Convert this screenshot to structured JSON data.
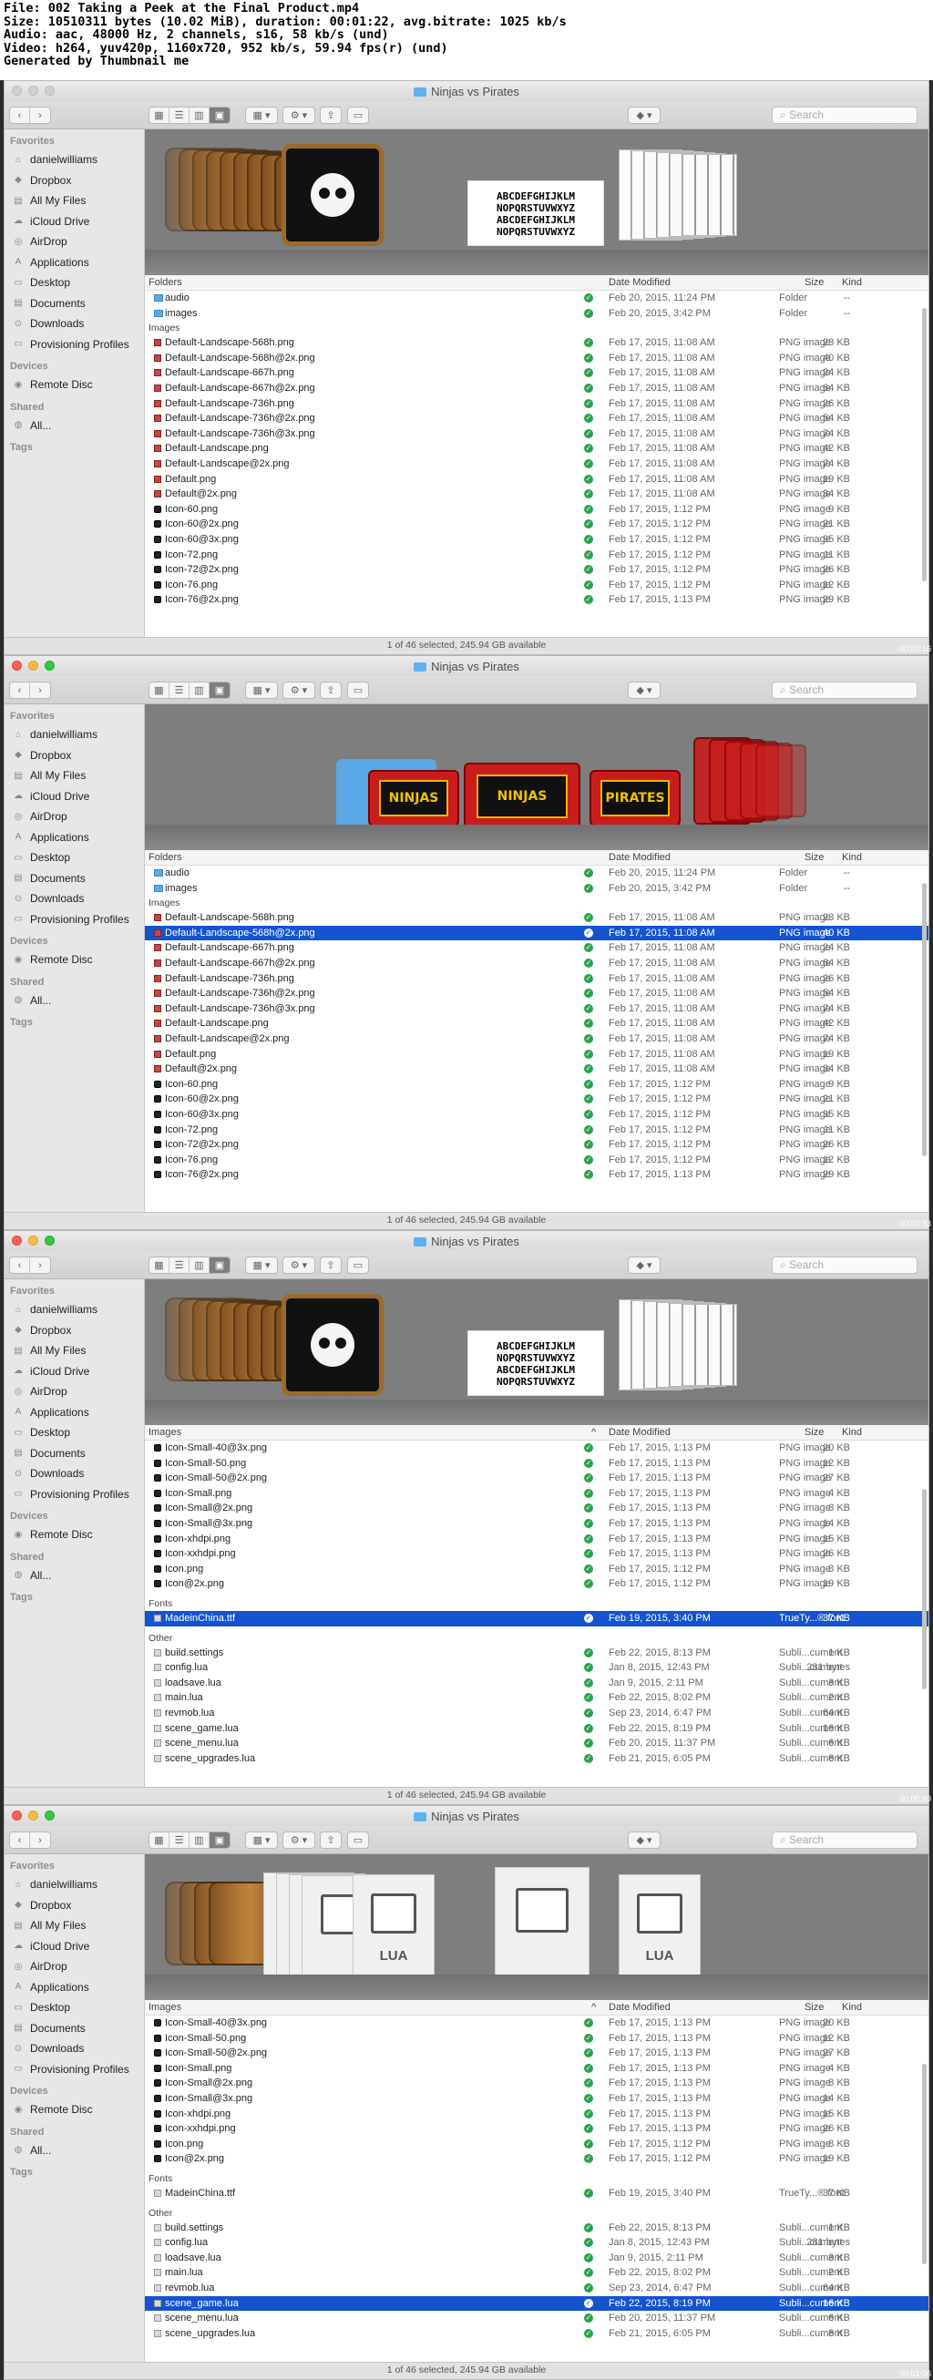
{
  "header": [
    "File: 002 Taking a Peek at the Final Product.mp4",
    "Size: 10510311 bytes (10.02 MiB), duration: 00:01:22, avg.bitrate: 1025 kb/s",
    "Audio: aac, 48000 Hz, 2 channels, s16, 58 kb/s (und)",
    "Video: h264, yuv420p, 1160x720, 952 kb/s, 59.94 fps(r) (und)",
    "Generated by Thumbnail me"
  ],
  "window_title": "Ninjas vs Pirates",
  "search_placeholder": "Search",
  "sidebar": {
    "favorites_label": "Favorites",
    "favorites": [
      "danielwilliams",
      "Dropbox",
      "All My Files",
      "iCloud Drive",
      "AirDrop",
      "Applications",
      "Desktop",
      "Documents",
      "Downloads",
      "Provisioning Profiles"
    ],
    "favorite_icons": [
      "home-icon",
      "dropbox-icon",
      "all-files-icon",
      "cloud-icon",
      "airdrop-icon",
      "applications-icon",
      "desktop-icon",
      "documents-icon",
      "downloads-icon",
      "folder-icon"
    ],
    "devices_label": "Devices",
    "devices": [
      "Remote Disc"
    ],
    "shared_label": "Shared",
    "shared": [
      "All..."
    ],
    "tags_label": "Tags"
  },
  "columns": {
    "name_folders": "Folders",
    "name_images": "Images",
    "date": "Date Modified",
    "size": "Size",
    "kind": "Kind"
  },
  "groups": {
    "images": "Images",
    "fonts": "Fonts",
    "other": "Other"
  },
  "status_text": "1 of 46 selected, 245.94 GB available",
  "timestamps": [
    "00:00:16",
    "00:00:33",
    "00:00:49",
    "00:01:06"
  ],
  "coverflow_labels": [
    "MadeinChina.ttf",
    "Default-Landscape-568h@2x.png",
    "MadeinChina.ttf",
    "scene_game.lua"
  ],
  "cover_text": {
    "font_preview": [
      "ABCDEFGHIJKLM",
      "NOPQRSTUVWXYZ",
      "ABCDEFGHIJKLM",
      "NOPQRSTUVWXYZ"
    ],
    "ninjas_title": "NINJAS",
    "pirates_title": "PIRATES",
    "lua": "LUA"
  },
  "folders": [
    {
      "name": "audio",
      "date": "Feb 20, 2015, 11:24 PM",
      "size": "--",
      "kind": "Folder"
    },
    {
      "name": "images",
      "date": "Feb 20, 2015, 3:42 PM",
      "size": "--",
      "kind": "Folder"
    }
  ],
  "images_top": [
    {
      "name": "Default-Landscape-568h.png",
      "date": "Feb 17, 2015, 11:08 AM",
      "size": "23 KB",
      "kind": "PNG image"
    },
    {
      "name": "Default-Landscape-568h@2x.png",
      "date": "Feb 17, 2015, 11:08 AM",
      "size": "40 KB",
      "kind": "PNG image"
    },
    {
      "name": "Default-Landscape-667h.png",
      "date": "Feb 17, 2015, 11:08 AM",
      "size": "24 KB",
      "kind": "PNG image"
    },
    {
      "name": "Default-Landscape-667h@2x.png",
      "date": "Feb 17, 2015, 11:08 AM",
      "size": "64 KB",
      "kind": "PNG image"
    },
    {
      "name": "Default-Landscape-736h.png",
      "date": "Feb 17, 2015, 11:08 AM",
      "size": "26 KB",
      "kind": "PNG image"
    },
    {
      "name": "Default-Landscape-736h@2x.png",
      "date": "Feb 17, 2015, 11:08 AM",
      "size": "54 KB",
      "kind": "PNG image"
    },
    {
      "name": "Default-Landscape-736h@3x.png",
      "date": "Feb 17, 2015, 11:08 AM",
      "size": "74 KB",
      "kind": "PNG image"
    },
    {
      "name": "Default-Landscape.png",
      "date": "Feb 17, 2015, 11:08 AM",
      "size": "42 KB",
      "kind": "PNG image"
    },
    {
      "name": "Default-Landscape@2x.png",
      "date": "Feb 17, 2015, 11:08 AM",
      "size": "74 KB",
      "kind": "PNG image"
    },
    {
      "name": "Default.png",
      "date": "Feb 17, 2015, 11:08 AM",
      "size": "19 KB",
      "kind": "PNG image"
    },
    {
      "name": "Default@2x.png",
      "date": "Feb 17, 2015, 11:08 AM",
      "size": "34 KB",
      "kind": "PNG image"
    },
    {
      "name": "Icon-60.png",
      "date": "Feb 17, 2015, 1:12 PM",
      "size": "9 KB",
      "kind": "PNG image"
    },
    {
      "name": "Icon-60@2x.png",
      "date": "Feb 17, 2015, 1:12 PM",
      "size": "21 KB",
      "kind": "PNG image"
    },
    {
      "name": "Icon-60@3x.png",
      "date": "Feb 17, 2015, 1:12 PM",
      "size": "35 KB",
      "kind": "PNG image"
    },
    {
      "name": "Icon-72.png",
      "date": "Feb 17, 2015, 1:12 PM",
      "size": "11 KB",
      "kind": "PNG image"
    },
    {
      "name": "Icon-72@2x.png",
      "date": "Feb 17, 2015, 1:12 PM",
      "size": "26 KB",
      "kind": "PNG image"
    },
    {
      "name": "Icon-76.png",
      "date": "Feb 17, 2015, 1:12 PM",
      "size": "12 KB",
      "kind": "PNG image"
    },
    {
      "name": "Icon-76@2x.png",
      "date": "Feb 17, 2015, 1:13 PM",
      "size": "29 KB",
      "kind": "PNG image"
    }
  ],
  "images_bottom": [
    {
      "name": "Icon-Small-40@3x.png",
      "date": "Feb 17, 2015, 1:13 PM",
      "size": "20 KB",
      "kind": "PNG image"
    },
    {
      "name": "Icon-Small-50.png",
      "date": "Feb 17, 2015, 1:13 PM",
      "size": "12 KB",
      "kind": "PNG image"
    },
    {
      "name": "Icon-Small-50@2x.png",
      "date": "Feb 17, 2015, 1:13 PM",
      "size": "27 KB",
      "kind": "PNG image"
    },
    {
      "name": "Icon-Small.png",
      "date": "Feb 17, 2015, 1:13 PM",
      "size": "4 KB",
      "kind": "PNG image"
    },
    {
      "name": "Icon-Small@2x.png",
      "date": "Feb 17, 2015, 1:13 PM",
      "size": "8 KB",
      "kind": "PNG image"
    },
    {
      "name": "Icon-Small@3x.png",
      "date": "Feb 17, 2015, 1:13 PM",
      "size": "14 KB",
      "kind": "PNG image"
    },
    {
      "name": "Icon-xhdpi.png",
      "date": "Feb 17, 2015, 1:13 PM",
      "size": "15 KB",
      "kind": "PNG image"
    },
    {
      "name": "Icon-xxhdpi.png",
      "date": "Feb 17, 2015, 1:13 PM",
      "size": "26 KB",
      "kind": "PNG image"
    },
    {
      "name": "Icon.png",
      "date": "Feb 17, 2015, 1:12 PM",
      "size": "8 KB",
      "kind": "PNG image"
    },
    {
      "name": "Icon@2x.png",
      "date": "Feb 17, 2015, 1:12 PM",
      "size": "19 KB",
      "kind": "PNG image"
    }
  ],
  "fonts": [
    {
      "name": "MadeinChina.ttf",
      "date": "Feb 19, 2015, 3:40 PM",
      "size": "37 KB",
      "kind": "TrueTy...® font"
    }
  ],
  "other": [
    {
      "name": "build.settings",
      "date": "Feb 22, 2015, 8:13 PM",
      "size": "1 KB",
      "kind": "Subli...cument"
    },
    {
      "name": "config.lua",
      "date": "Jan 8, 2015, 12:43 PM",
      "size": "281 bytes",
      "kind": "Subli...cument"
    },
    {
      "name": "loadsave.lua",
      "date": "Jan 9, 2015, 2:11 PM",
      "size": "3 KB",
      "kind": "Subli...cument"
    },
    {
      "name": "main.lua",
      "date": "Feb 22, 2015, 8:02 PM",
      "size": "2 KB",
      "kind": "Subli...cument"
    },
    {
      "name": "revmob.lua",
      "date": "Sep 23, 2014, 6:47 PM",
      "size": "64 KB",
      "kind": "Subli...cument"
    },
    {
      "name": "scene_game.lua",
      "date": "Feb 22, 2015, 8:19 PM",
      "size": "16 KB",
      "kind": "Subli...cument"
    },
    {
      "name": "scene_menu.lua",
      "date": "Feb 20, 2015, 11:37 PM",
      "size": "6 KB",
      "kind": "Subli...cument"
    },
    {
      "name": "scene_upgrades.lua",
      "date": "Feb 21, 2015, 6:05 PM",
      "size": "8 KB",
      "kind": "Subli...cument"
    }
  ]
}
